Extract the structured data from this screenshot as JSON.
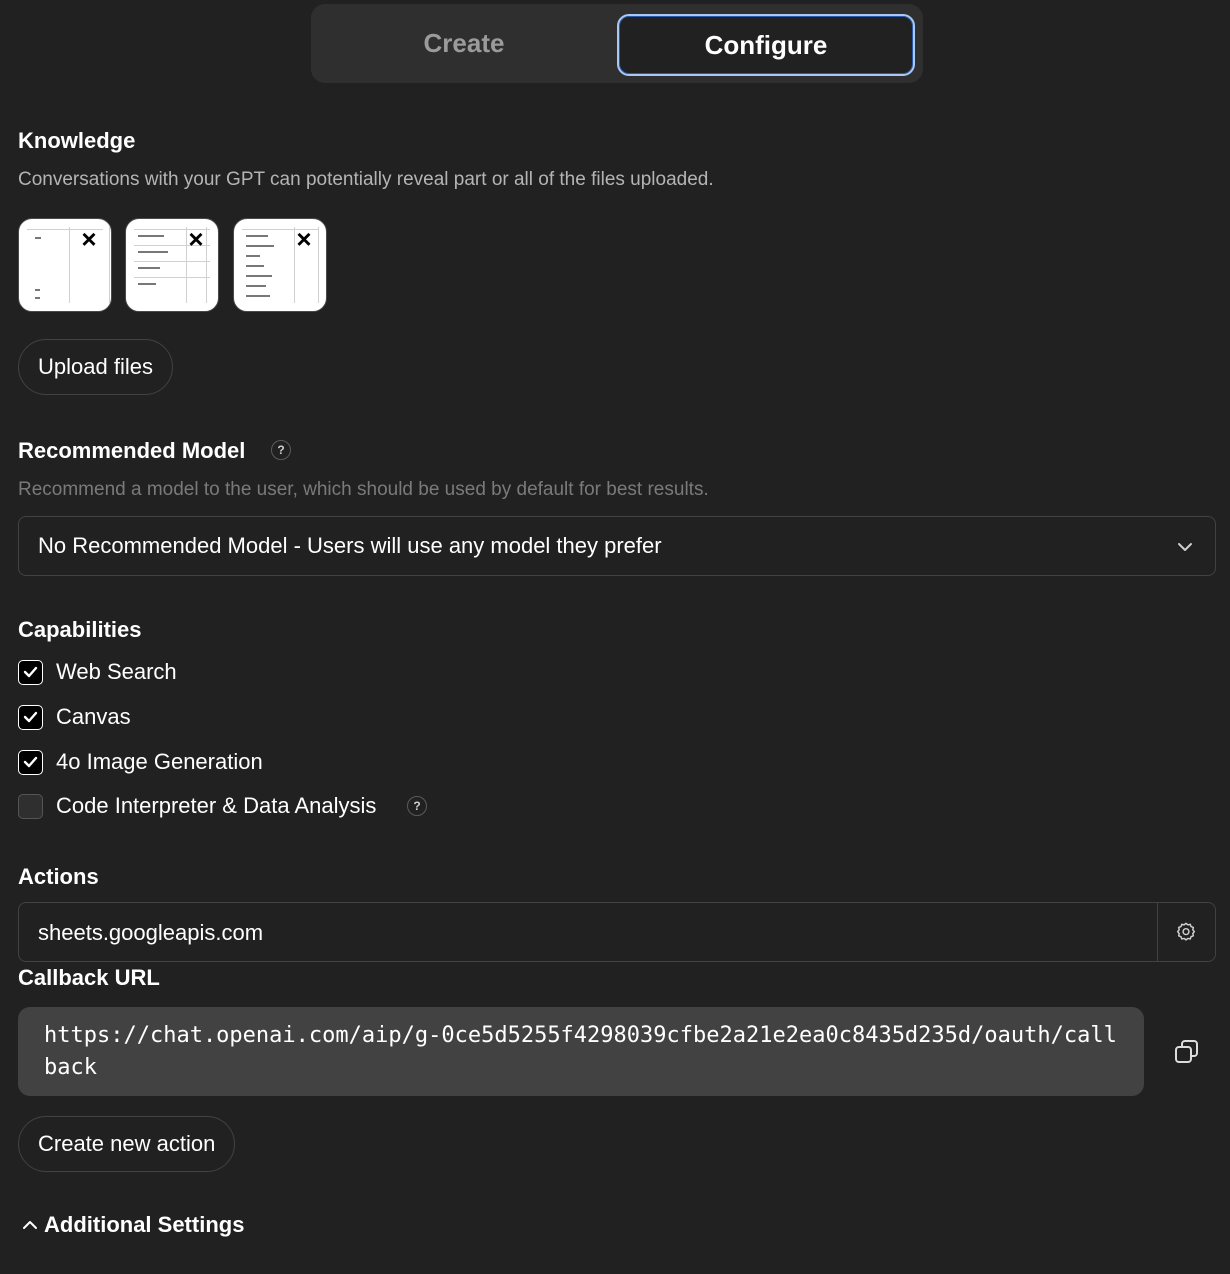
{
  "tabs": {
    "create": "Create",
    "configure": "Configure"
  },
  "knowledge": {
    "title": "Knowledge",
    "description": "Conversations with your GPT can potentially reveal part or all of the files uploaded.",
    "upload_label": "Upload files"
  },
  "recommended_model": {
    "title": "Recommended Model",
    "help": "?",
    "description": "Recommend a model to the user, which should be used by default for best results.",
    "selected": "No Recommended Model - Users will use any model they prefer"
  },
  "capabilities": {
    "title": "Capabilities",
    "items": [
      {
        "label": "Web Search",
        "checked": true
      },
      {
        "label": "Canvas",
        "checked": true
      },
      {
        "label": "4o Image Generation",
        "checked": true
      },
      {
        "label": "Code Interpreter & Data Analysis",
        "checked": false
      }
    ],
    "help": "?"
  },
  "actions": {
    "title": "Actions",
    "items": [
      {
        "domain": "sheets.googleapis.com"
      }
    ],
    "callback_title": "Callback URL",
    "callback_url": "https://chat.openai.com/aip/g-0ce5d5255f4298039cfbe2a21e2ea0c8435d235d/oauth/callback",
    "create_label": "Create new action"
  },
  "additional_settings": {
    "label": "Additional Settings"
  },
  "colors": {
    "background": "#212121",
    "accent_border": "#a9c8f5",
    "code_bg": "#424242"
  }
}
